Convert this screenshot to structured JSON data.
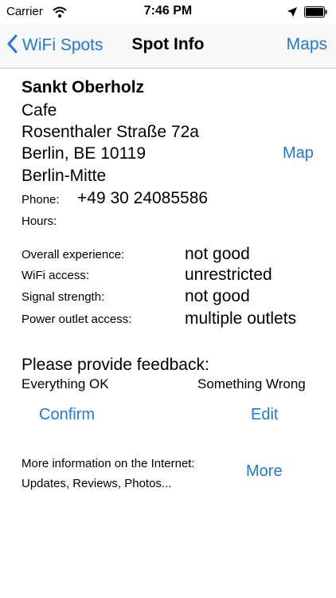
{
  "status_bar": {
    "carrier": "Carrier",
    "time": "7:46 PM"
  },
  "nav": {
    "back_label": "WiFi Spots",
    "title": "Spot Info",
    "right_label": "Maps"
  },
  "spot": {
    "name": "Sankt Oberholz",
    "category": "Cafe",
    "street": "Rosenthaler Straße 72a",
    "city_line": "Berlin, BE 10119",
    "district": "Berlin-Mitte",
    "map_link": "Map",
    "phone_label": "Phone:",
    "phone": "+49 30 24085586",
    "hours_label": "Hours:"
  },
  "ratings": [
    {
      "label": "Overall experience:",
      "value": "not good"
    },
    {
      "label": "WiFi access:",
      "value": "unrestricted"
    },
    {
      "label": "Signal strength:",
      "value": "not good"
    },
    {
      "label": "Power outlet access:",
      "value": "multiple outlets"
    }
  ],
  "feedback": {
    "prompt": "Please provide feedback:",
    "ok_label": "Everything OK",
    "wrong_label": "Something Wrong",
    "confirm_button": "Confirm",
    "edit_button": "Edit"
  },
  "more_info": {
    "line1": "More information on the Internet:",
    "line2": "Updates, Reviews, Photos...",
    "more_button": "More"
  },
  "colors": {
    "accent": "#1e7ad8"
  }
}
